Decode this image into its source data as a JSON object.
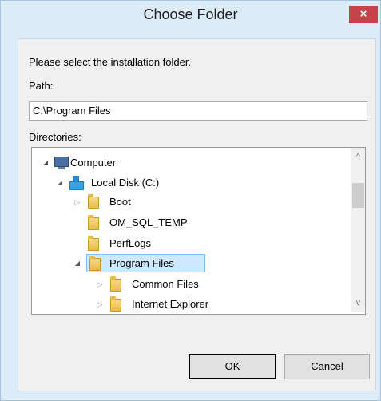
{
  "window": {
    "title": "Choose Folder",
    "close_glyph": "×"
  },
  "dialog": {
    "instruction": "Please select the installation folder.",
    "path_label": "Path:",
    "path_value": "C:\\Program Files",
    "directories_label": "Directories:"
  },
  "tree": {
    "items": [
      {
        "label": "Computer",
        "icon": "computer-icon",
        "expander": "expanded"
      },
      {
        "label": "Local Disk (C:)",
        "icon": "drive-icon",
        "expander": "expanded"
      },
      {
        "label": "Boot",
        "icon": "folder-icon",
        "expander": "collapsed"
      },
      {
        "label": "OM_SQL_TEMP",
        "icon": "folder-icon",
        "expander": "none"
      },
      {
        "label": "PerfLogs",
        "icon": "folder-icon",
        "expander": "none"
      },
      {
        "label": "Program Files",
        "icon": "folder-icon",
        "expander": "expanded",
        "selected": true
      },
      {
        "label": "Common Files",
        "icon": "folder-icon",
        "expander": "collapsed"
      },
      {
        "label": "Internet Explorer",
        "icon": "folder-icon",
        "expander": "collapsed"
      }
    ],
    "expand_glyph": "◢",
    "collapse_glyph": "▷",
    "scroll_up_glyph": "^",
    "scroll_down_glyph": "v"
  },
  "buttons": {
    "ok": "OK",
    "cancel": "Cancel"
  },
  "colors": {
    "close": "#c7424a",
    "selection": "#cde8ff",
    "frame": "#dcebf8"
  }
}
